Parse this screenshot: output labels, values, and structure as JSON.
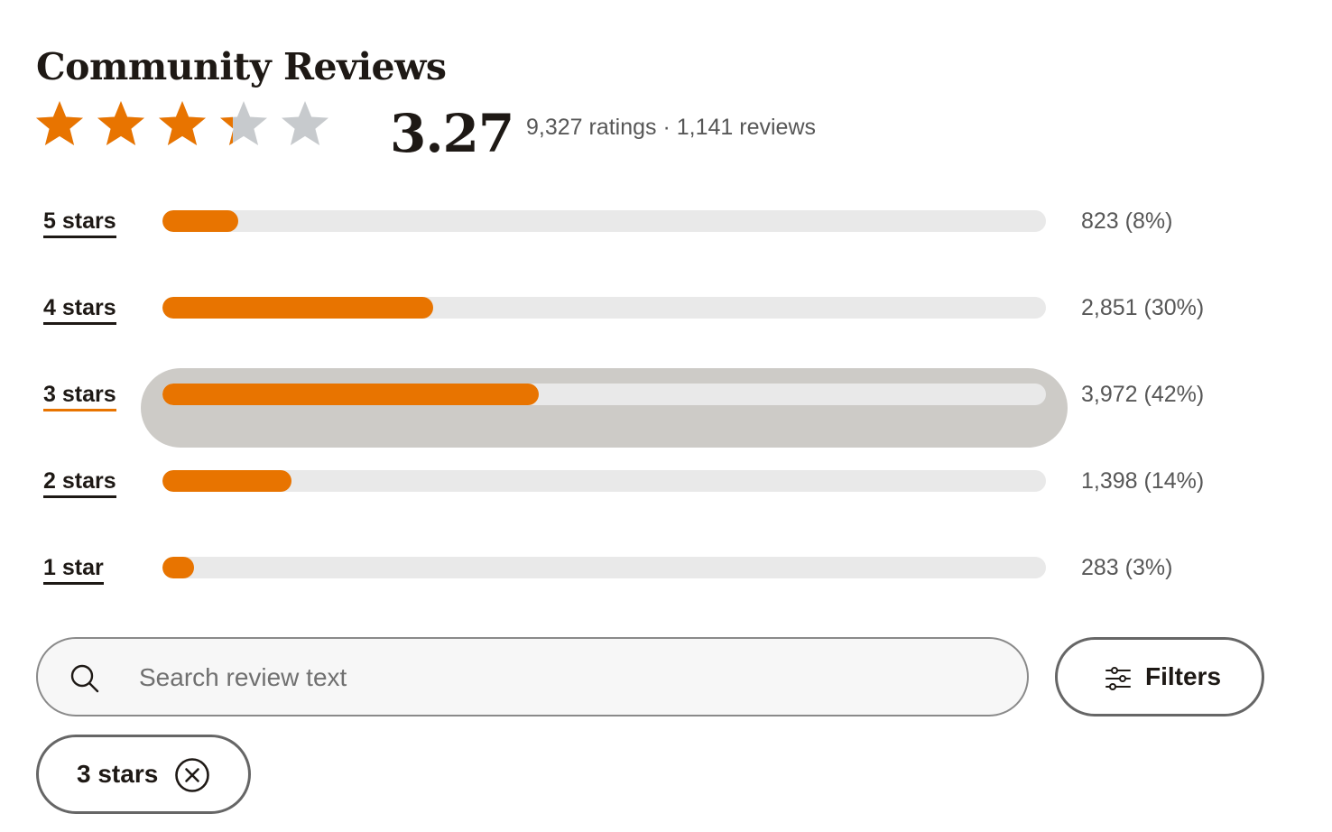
{
  "title": "Community Reviews",
  "rating": {
    "average": "3.27",
    "average_value": 3.27,
    "max_stars": 5,
    "summary": "9,327 ratings · 1,141 reviews",
    "star_color": "#e87400",
    "empty_star_color": "#c7cacd"
  },
  "histogram": [
    {
      "label": "5 stars",
      "count": "823 (8%)",
      "fraction": 0.08,
      "active": false
    },
    {
      "label": "4 stars",
      "count": "2,851 (30%)",
      "fraction": 0.3,
      "active": false
    },
    {
      "label": "3 stars",
      "count": "3,972 (42%)",
      "fraction": 0.42,
      "active": true
    },
    {
      "label": "2 stars",
      "count": "1,398 (14%)",
      "fraction": 0.14,
      "active": false
    },
    {
      "label": "1 star",
      "count": "283 (3%)",
      "fraction": 0.03,
      "active": false
    }
  ],
  "colors": {
    "bar_fill": "#e87400",
    "bar_track": "#e9e9e9",
    "active_row_highlight": "#cdcbc7",
    "active_underline": "#e87400"
  },
  "search": {
    "placeholder": "Search review text",
    "value": "",
    "icon": "search-icon"
  },
  "filters_button": {
    "label": "Filters",
    "icon": "sliders-icon"
  },
  "active_filter_chip": {
    "label": "3 stars",
    "icon": "close-circle-icon"
  }
}
